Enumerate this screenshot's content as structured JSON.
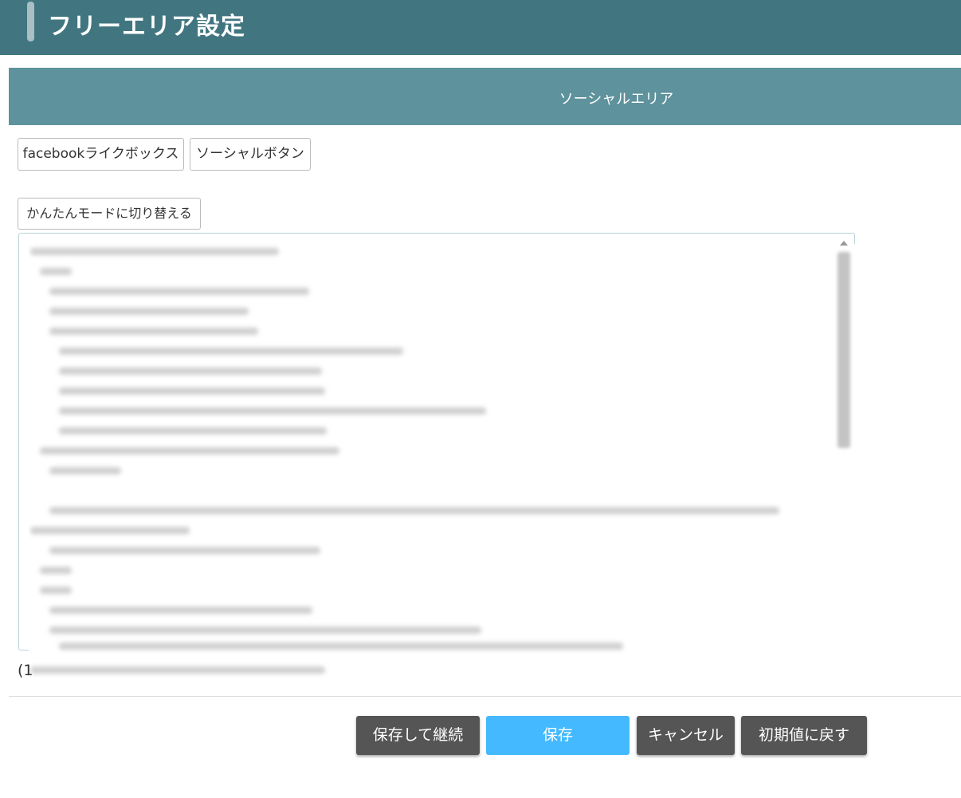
{
  "header": {
    "title": "フリーエリア設定"
  },
  "section": {
    "title": "ソーシャルエリア"
  },
  "tabs": [
    {
      "label": "facebookライクボックス"
    },
    {
      "label": "ソーシャルボタン"
    }
  ],
  "mode_switch": {
    "label": "かんたんモードに切り替える"
  },
  "note": {
    "prefix": "(1"
  },
  "actions": {
    "save_continue": "保存して継続",
    "save": "保存",
    "cancel": "キャンセル",
    "reset": "初期値に戻す"
  }
}
